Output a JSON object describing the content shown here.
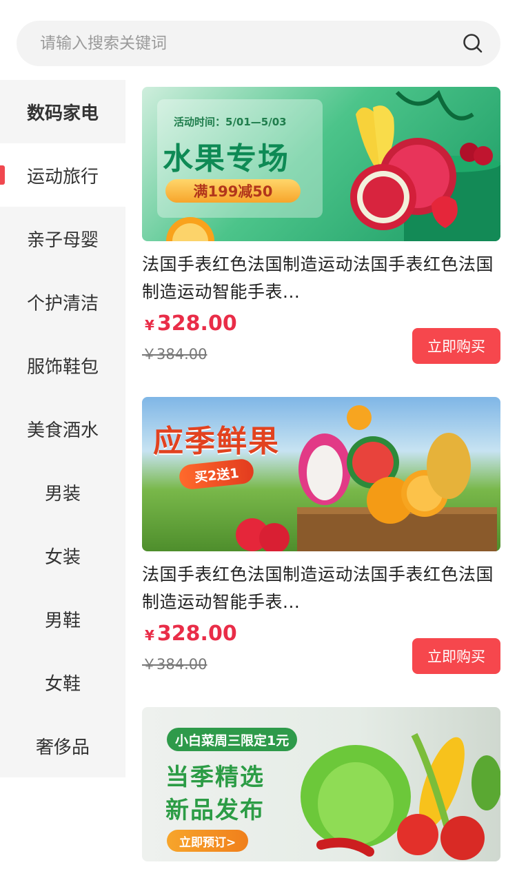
{
  "search": {
    "placeholder": "请输入搜索关键词",
    "icon": "search-icon"
  },
  "sidebar": {
    "items": [
      {
        "label": "数码家电",
        "active": false
      },
      {
        "label": "运动旅行",
        "active": true
      },
      {
        "label": "亲子母婴",
        "active": false
      },
      {
        "label": "个护清洁",
        "active": false
      },
      {
        "label": "服饰鞋包",
        "active": false
      },
      {
        "label": "美食酒水",
        "active": false
      },
      {
        "label": "男装",
        "active": false
      },
      {
        "label": "女装",
        "active": false
      },
      {
        "label": "男鞋",
        "active": false
      },
      {
        "label": "女鞋",
        "active": false
      },
      {
        "label": "奢侈品",
        "active": false
      }
    ]
  },
  "products": [
    {
      "banner": {
        "period": "活动时间：5/01—5/03",
        "headline": "水果专场",
        "promo": "满199减50"
      },
      "title": "法国手表红色法国制造运动法国手表红色法国制造运动智能手表...",
      "currency": "¥",
      "price": "328.00",
      "original_price": "￥384.00",
      "buy_label": "立即购买"
    },
    {
      "banner": {
        "headline": "应季鲜果",
        "promo": "买2送1"
      },
      "title": "法国手表红色法国制造运动法国手表红色法国制造运动智能手表...",
      "currency": "¥",
      "price": "328.00",
      "original_price": "￥384.00",
      "buy_label": "立即购买"
    },
    {
      "banner": {
        "tag": "小白菜周三限定1元",
        "line1": "当季精选",
        "line2": "新品发布",
        "cta": "立即预订>"
      }
    }
  ],
  "colors": {
    "accent": "#f6474d",
    "price": "#e92d48",
    "sidebar_bg": "#f5f5f5"
  }
}
